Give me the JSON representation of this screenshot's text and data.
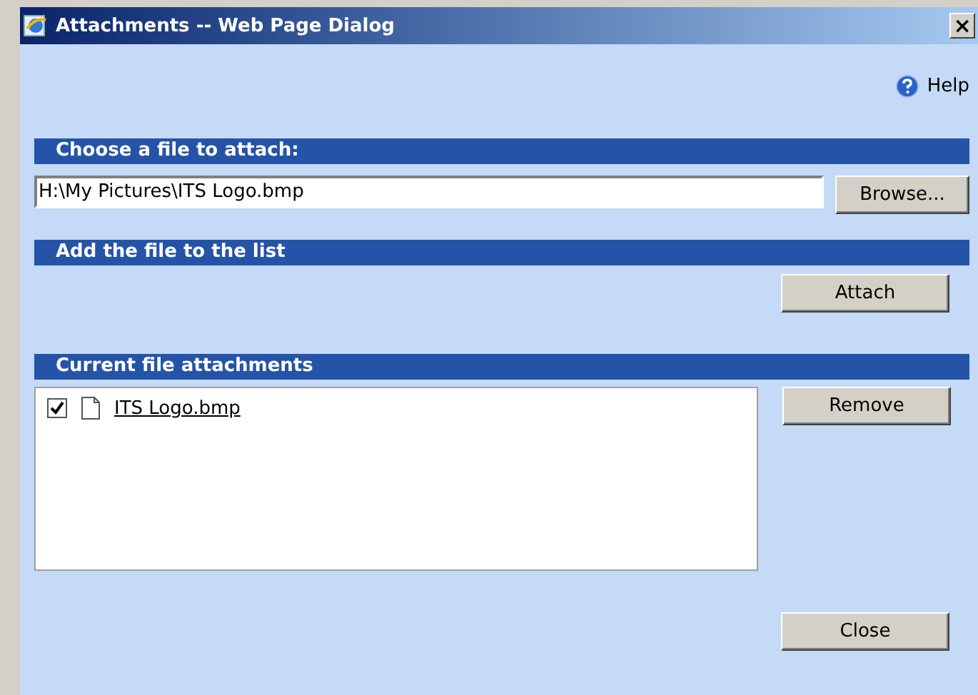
{
  "window": {
    "title": "Attachments -- Web Page Dialog",
    "close": "×"
  },
  "help": {
    "label": "Help"
  },
  "choose_section": {
    "heading": "Choose a file to attach:",
    "file_field": {
      "value": "H:\\My Pictures\\ITS Logo.bmp"
    },
    "button": "Browse..."
  },
  "add_section": {
    "heading": "Add the file to the list",
    "button": "Attach"
  },
  "attachments_section": {
    "heading": "Current file attachments",
    "items": [
      {
        "name": "ITS Logo.bmp",
        "checked": true
      }
    ],
    "button": "Remove"
  },
  "footer": {
    "button": "Close"
  }
}
